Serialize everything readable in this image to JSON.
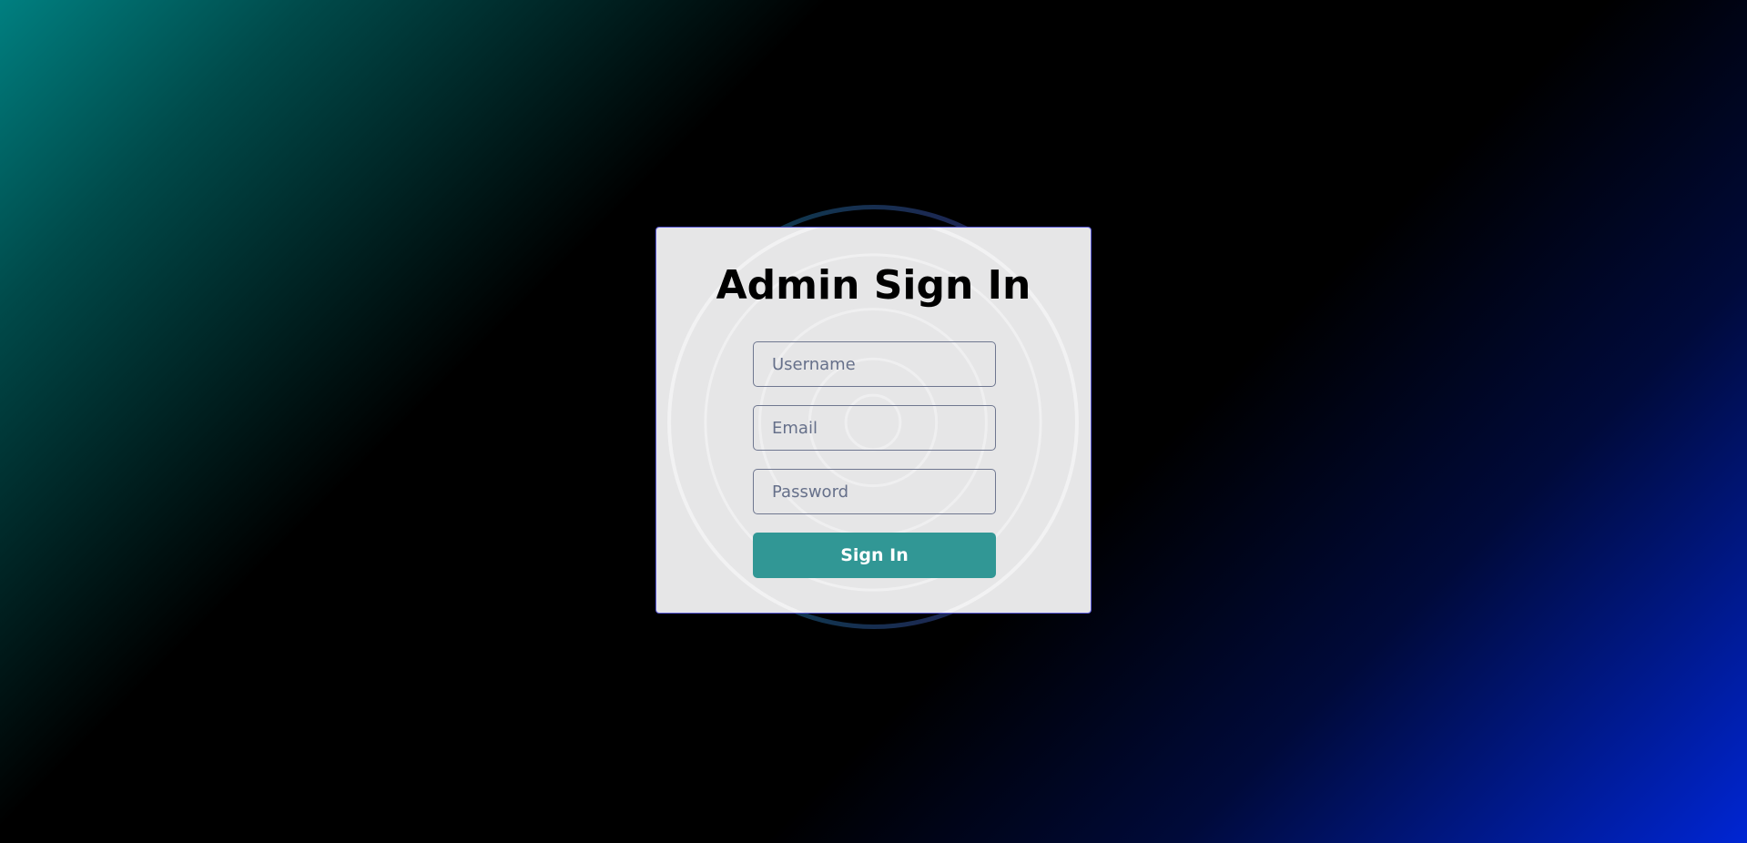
{
  "signin": {
    "title": "Admin Sign In",
    "username_placeholder": "Username",
    "email_placeholder": "Email",
    "password_placeholder": "Password",
    "submit_label": "Sign In"
  },
  "colors": {
    "button": "#319795",
    "card": "#e6e6e7",
    "card_border": "#5a5ad6",
    "background_top_left": "#007f80",
    "background_bottom_right": "#0026d4"
  }
}
